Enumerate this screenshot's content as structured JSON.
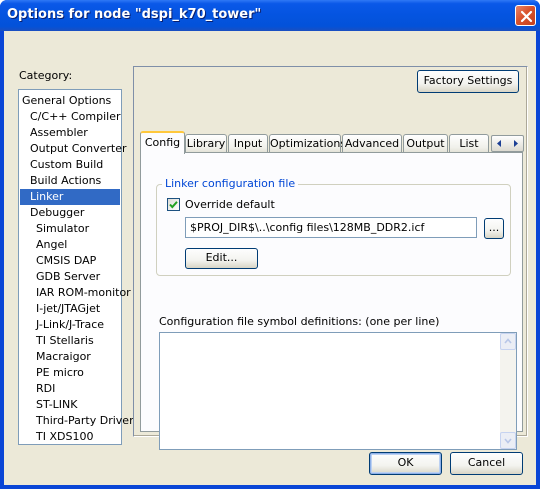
{
  "window": {
    "title": "Options for node \"dspi_k70_tower\""
  },
  "category": {
    "label": "Category:",
    "items": [
      {
        "label": "General Options",
        "indent": false
      },
      {
        "label": "C/C++ Compiler",
        "indent": true
      },
      {
        "label": "Assembler",
        "indent": true
      },
      {
        "label": "Output Converter",
        "indent": true
      },
      {
        "label": "Custom Build",
        "indent": true
      },
      {
        "label": "Build Actions",
        "indent": true
      },
      {
        "label": "Linker",
        "indent": true,
        "selected": true
      },
      {
        "label": "Debugger",
        "indent": true
      },
      {
        "label": "Simulator",
        "indent": true,
        "level": 2
      },
      {
        "label": "Angel",
        "indent": true,
        "level": 2
      },
      {
        "label": "CMSIS DAP",
        "indent": true,
        "level": 2
      },
      {
        "label": "GDB Server",
        "indent": true,
        "level": 2
      },
      {
        "label": "IAR ROM-monitor",
        "indent": true,
        "level": 2
      },
      {
        "label": "I-jet/JTAGjet",
        "indent": true,
        "level": 2
      },
      {
        "label": "J-Link/J-Trace",
        "indent": true,
        "level": 2
      },
      {
        "label": "TI Stellaris",
        "indent": true,
        "level": 2
      },
      {
        "label": "Macraigor",
        "indent": true,
        "level": 2
      },
      {
        "label": "PE micro",
        "indent": true,
        "level": 2
      },
      {
        "label": "RDI",
        "indent": true,
        "level": 2
      },
      {
        "label": "ST-LINK",
        "indent": true,
        "level": 2
      },
      {
        "label": "Third-Party Driver",
        "indent": true,
        "level": 2
      },
      {
        "label": "TI XDS100",
        "indent": true,
        "level": 2
      }
    ]
  },
  "panel": {
    "factory_settings": "Factory Settings",
    "tabs": [
      "Config",
      "Library",
      "Input",
      "Optimizations",
      "Advanced",
      "Output",
      "List"
    ],
    "active_tab": "Config",
    "linker_group": {
      "legend": "Linker configuration file",
      "override_label": "Override default",
      "override_checked": true,
      "path": "$PROJ_DIR$\\..\\config files\\128MB_DDR2.icf",
      "browse_label": "...",
      "edit_label": "Edit..."
    },
    "symbols_label": "Configuration file symbol definitions: (one per line)",
    "symbols_value": ""
  },
  "footer": {
    "ok": "OK",
    "cancel": "Cancel"
  },
  "colors": {
    "title_blue": "#0454e0",
    "selection": "#316ac5",
    "dialog_bg": "#ece9d8",
    "group_legend": "#0046d5",
    "active_tab_accent": "#ffc83c"
  },
  "icons": {
    "close": "close-icon",
    "tab_scroll_left": "arrow-left-icon",
    "tab_scroll_right": "arrow-right-icon",
    "checkbox": "checkmark-icon",
    "scroll_up": "scroll-up-icon",
    "scroll_down": "scroll-down-icon"
  }
}
